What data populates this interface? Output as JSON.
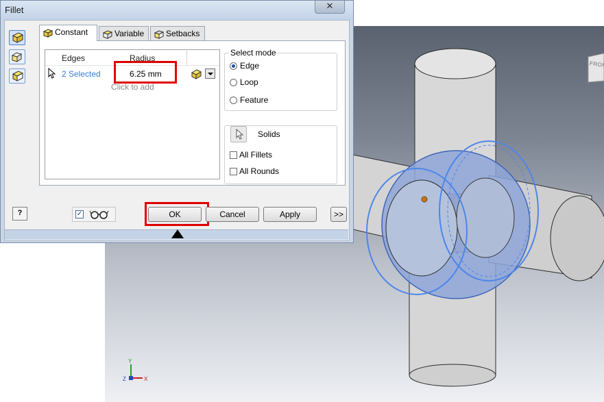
{
  "dialog": {
    "title": "Fillet",
    "close_label": "✕",
    "tabs": [
      {
        "label": "Constant",
        "active": true
      },
      {
        "label": "Variable",
        "active": false
      },
      {
        "label": "Setbacks",
        "active": false
      }
    ],
    "table": {
      "headers": [
        "Edges",
        "Radius"
      ],
      "rows": [
        {
          "edges": "2 Selected",
          "radius": "6.25 mm"
        }
      ],
      "add_row_hint": "Click to add"
    },
    "select_mode": {
      "legend": "Select mode",
      "options": [
        {
          "label": "Edge",
          "selected": true
        },
        {
          "label": "Loop",
          "selected": false
        },
        {
          "label": "Feature",
          "selected": false
        }
      ]
    },
    "solids": {
      "label": "Solids",
      "checkboxes": [
        {
          "label": "All Fillets",
          "checked": false
        },
        {
          "label": "All Rounds",
          "checked": false
        }
      ]
    },
    "buttons": {
      "help": "?",
      "ok": "OK",
      "cancel": "Cancel",
      "apply": "Apply",
      "more": ">>"
    },
    "preview_checked": true
  },
  "viewport": {
    "viewcube_face": "FRONT",
    "triad": {
      "x": "X",
      "y": "Y",
      "z": "Z"
    }
  },
  "colors": {
    "highlight": "#e00000",
    "selection": "#3a7bd5",
    "accent": "#5b8fe0"
  }
}
